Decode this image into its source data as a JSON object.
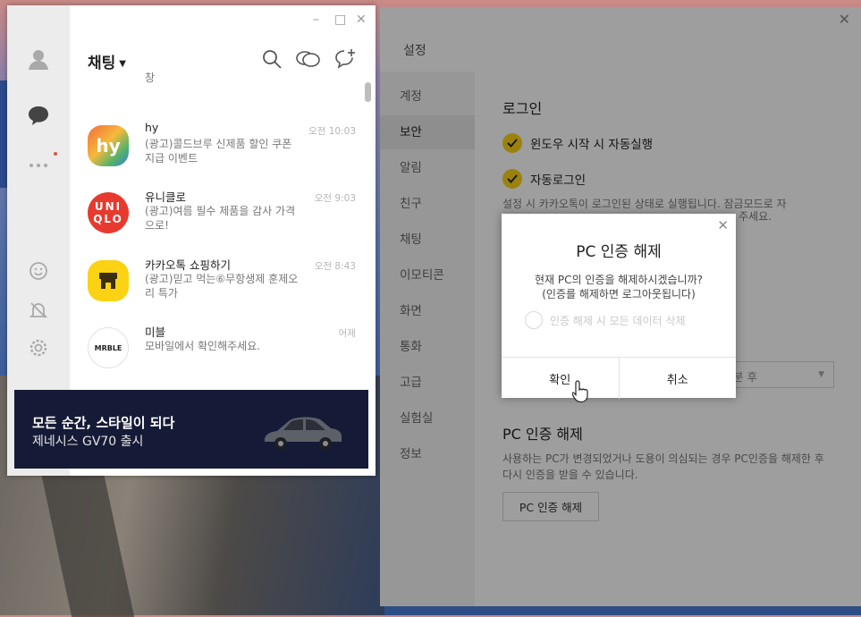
{
  "chat_window": {
    "title": "채팅",
    "controls": {
      "minimize": "–",
      "maximize": "□",
      "close": "✕"
    },
    "partial_top_item": {
      "msg": "창"
    },
    "items": [
      {
        "name": "hy",
        "msg": "(광고)콜드브루 신제품 할인 쿠폰 지급 이벤트",
        "time": "오전 10:03",
        "avatar": "hy"
      },
      {
        "name": "유니클로",
        "msg": "(광고)여름 필수 제품을 감사 가격으로!",
        "time": "오전 9:03",
        "avatar": "UNI QLO"
      },
      {
        "name": "카카오톡 쇼핑하기",
        "msg": "(광고)믿고 먹는⑥무항생제 훈제오리 특가",
        "time": "오전 8:43",
        "avatar": "shop"
      },
      {
        "name": "미블",
        "msg": "모바일에서 확인해주세요.",
        "time": "어제",
        "avatar": "MRBLE"
      }
    ],
    "banner": {
      "line1": "모든 순간, 스타일이 되다",
      "line2": "제네시스 GV70 출시"
    }
  },
  "settings": {
    "title": "설정",
    "close": "✕",
    "nav": [
      "계정",
      "보안",
      "알림",
      "친구",
      "채팅",
      "이모티콘",
      "화면",
      "통화",
      "고급",
      "실험실",
      "정보"
    ],
    "nav_active": "보안",
    "login_title": "로그인",
    "opt_autorun": "윈도우 시작 시 자동실행",
    "opt_autologin": "자동로그인",
    "login_desc_visible": "설정 시 카카오톡이 로그인된 상태로 실행됩니다. 잠금모드로 자",
    "login_desc_tail": "주세요.",
    "select_fragment": "분 후",
    "pc_cert_title": "PC 인증 해제",
    "pc_cert_desc": "사용하는 PC가 변경되었거나 도용이 의심되는 경우 PC인증을 해제한 후 다시 인증을 받을 수 있습니다.",
    "pc_cert_button": "PC 인증 해제"
  },
  "dialog": {
    "title": "PC 인증 해제",
    "message_line1": "현재 PC의 인증을 해제하시겠습니까?",
    "message_line2": "(인증를 해제하면 로그아웃됩니다)",
    "option": "인증 해제 시 모든 데이터 삭제",
    "ok": "확인",
    "cancel": "취소",
    "close": "✕"
  },
  "colors": {
    "accent_yellow": "#fbd214",
    "banner_bg": "#151b36"
  }
}
